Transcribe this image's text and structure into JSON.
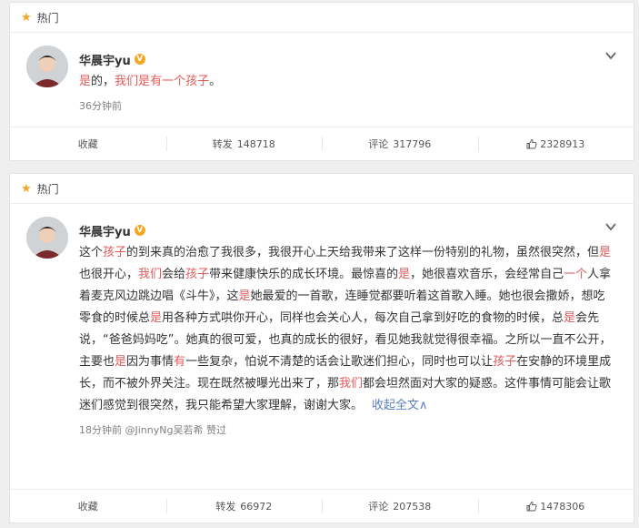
{
  "posts": [
    {
      "hot_label": "热门",
      "author": "华晨宇yu",
      "badge": "V",
      "content_segments": [
        {
          "t": "是",
          "kw": true
        },
        {
          "t": "的，",
          "kw": false
        },
        {
          "t": "我们",
          "kw": true
        },
        {
          "t": "是",
          "kw": true
        },
        {
          "t": "有",
          "kw": true
        },
        {
          "t": "一个",
          "kw": true
        },
        {
          "t": "孩子",
          "kw": true
        },
        {
          "t": "。",
          "kw": false
        }
      ],
      "time": "36分钟前",
      "actions": {
        "collect": "收藏",
        "repost_label": "转发",
        "repost_count": "148718",
        "comment_label": "评论",
        "comment_count": "317796",
        "like_count": "2328913"
      }
    },
    {
      "hot_label": "热门",
      "author": "华晨宇yu",
      "badge": "V",
      "content_segments": [
        {
          "t": "这个",
          "kw": false
        },
        {
          "t": "孩子",
          "kw": true
        },
        {
          "t": "的到来真的治愈了我很多，我很开心上天给我带来了这样一份特别的礼物，虽然很突然，但",
          "kw": false
        },
        {
          "t": "是",
          "kw": true
        },
        {
          "t": "也很开心，",
          "kw": false
        },
        {
          "t": "我们",
          "kw": true
        },
        {
          "t": "会给",
          "kw": false
        },
        {
          "t": "孩子",
          "kw": true
        },
        {
          "t": "带来健康快乐的成长环境。最惊喜的",
          "kw": false
        },
        {
          "t": "是",
          "kw": true
        },
        {
          "t": "，她很喜欢音乐，会经常自己",
          "kw": false
        },
        {
          "t": "一个",
          "kw": true
        },
        {
          "t": "人拿着麦克风边跳边唱《斗牛》，这",
          "kw": false
        },
        {
          "t": "是",
          "kw": true
        },
        {
          "t": "她最爱的一首歌，连睡觉都要听着这首歌入睡。她也很会撒娇，想吃零食的时候总",
          "kw": false
        },
        {
          "t": "是",
          "kw": true
        },
        {
          "t": "用各种方式哄你开心，同样也会关心人，每次自己拿到好吃的食物的时候，总",
          "kw": false
        },
        {
          "t": "是",
          "kw": true
        },
        {
          "t": "会先说，“爸爸妈妈吃”。她真的很可爱，也真的成长的很好，看见她我就觉得很幸福。之所以一直不公开，主要也",
          "kw": false
        },
        {
          "t": "是",
          "kw": true
        },
        {
          "t": "因为事情",
          "kw": false
        },
        {
          "t": "有",
          "kw": true
        },
        {
          "t": "一些复杂，怕说不清楚的话会让歌迷们担心，同时也可以让",
          "kw": false
        },
        {
          "t": "孩子",
          "kw": true
        },
        {
          "t": "在安静的环境里成长，而不被外界关注。现在既然被曝光出来了，那",
          "kw": false
        },
        {
          "t": "我们",
          "kw": true
        },
        {
          "t": "都会坦然面对大家的疑惑。这件事情可能会让歌迷们感觉到很突然，我只能希望大家理解，谢谢大家。",
          "kw": false
        }
      ],
      "fold_label": "收起全文∧",
      "time": "18分钟前 @JinnyNg吴若希 赞过",
      "actions": {
        "collect": "收藏",
        "repost_label": "转发",
        "repost_count": "66972",
        "comment_label": "评论",
        "comment_count": "207538",
        "like_count": "1478306"
      }
    }
  ],
  "colors": {
    "keyword": "#e05a5a",
    "link": "#5a7fbd",
    "badge": "#f5a623",
    "hot_star": "#f5a623"
  },
  "icons": {
    "hot": "star-icon",
    "more": "chevron-down-icon",
    "verified": "verified-badge-icon",
    "like": "thumbs-up-icon"
  }
}
